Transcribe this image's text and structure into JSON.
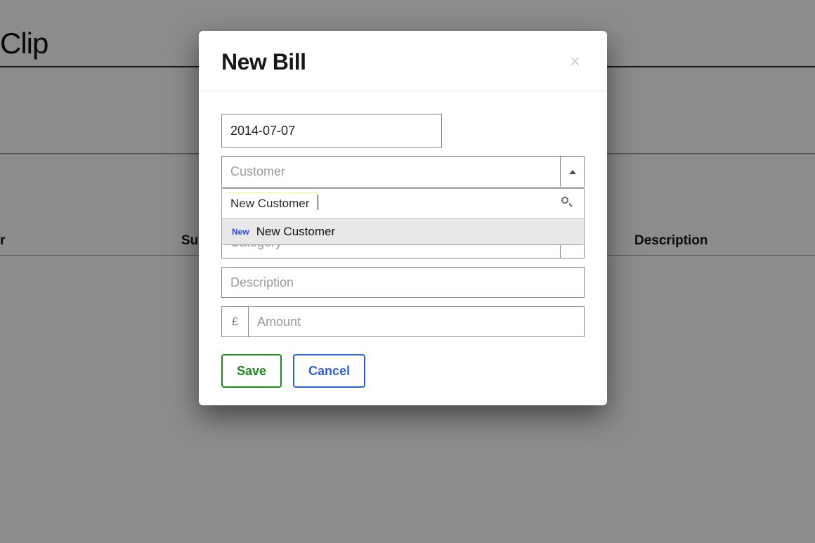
{
  "brand": "Clip",
  "table": {
    "col_supplier": "Supplier",
    "col_description": "Description",
    "col_r": "r"
  },
  "modal": {
    "title": "New Bill",
    "close_glyph": "×",
    "date_value": "2014-07-07",
    "customer_placeholder": "Customer",
    "category_placeholder": "Category",
    "description_placeholder": "Description",
    "amount_currency": "£",
    "amount_placeholder": "Amount",
    "save_label": "Save",
    "cancel_label": "Cancel",
    "dropdown": {
      "search_value": "New Customer",
      "new_badge": "New",
      "option_text": "New Customer"
    }
  }
}
